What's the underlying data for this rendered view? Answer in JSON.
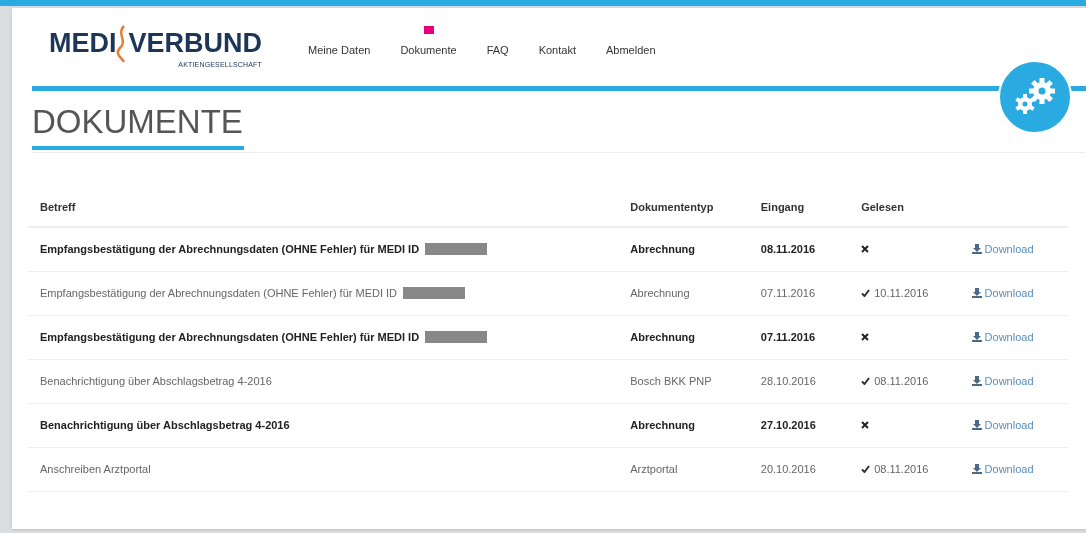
{
  "logo": {
    "left": "MEDI",
    "right": "VERBUND",
    "subtitle": "AKTIENGESELLSCHAFT"
  },
  "nav": [
    {
      "label": "Meine Daten",
      "badge": false
    },
    {
      "label": "Dokumente",
      "badge": true
    },
    {
      "label": "FAQ",
      "badge": false
    },
    {
      "label": "Kontakt",
      "badge": false
    },
    {
      "label": "Abmelden",
      "badge": false
    }
  ],
  "page_title": "DOKUMENTE",
  "table": {
    "columns": [
      "Betreff",
      "Dokumententyp",
      "Eingang",
      "Gelesen"
    ],
    "rows": [
      {
        "subject": "Empfangsbestätigung der Abrechnungsdaten (OHNE Fehler) für MEDI ID",
        "redacted": true,
        "type": "Abrechnung",
        "received": "08.11.2016",
        "read": false,
        "action": "Download"
      },
      {
        "subject": "Empfangsbestätigung der Abrechnungsdaten (OHNE Fehler) für MEDI ID",
        "redacted": true,
        "type": "Abrechnung",
        "received": "07.11.2016",
        "read": true,
        "read_date": "10.11.2016",
        "action": "Download"
      },
      {
        "subject": "Empfangsbestätigung der Abrechnungsdaten (OHNE Fehler) für MEDI ID",
        "redacted": true,
        "type": "Abrechnung",
        "received": "07.11.2016",
        "read": false,
        "action": "Download"
      },
      {
        "subject": "Benachrichtigung über Abschlagsbetrag 4-2016",
        "redacted": false,
        "type": "Bosch BKK PNP",
        "received": "28.10.2016",
        "read": true,
        "read_date": "08.11.2016",
        "action": "Download"
      },
      {
        "subject": "Benachrichtigung über Abschlagsbetrag 4-2016",
        "redacted": false,
        "type": "Abrechnung",
        "received": "27.10.2016",
        "read": false,
        "action": "Download"
      },
      {
        "subject": "Anschreiben Arztportal",
        "redacted": false,
        "type": "Arztportal",
        "received": "20.10.2016",
        "read": true,
        "read_date": "08.11.2016",
        "action": "Download"
      }
    ]
  }
}
